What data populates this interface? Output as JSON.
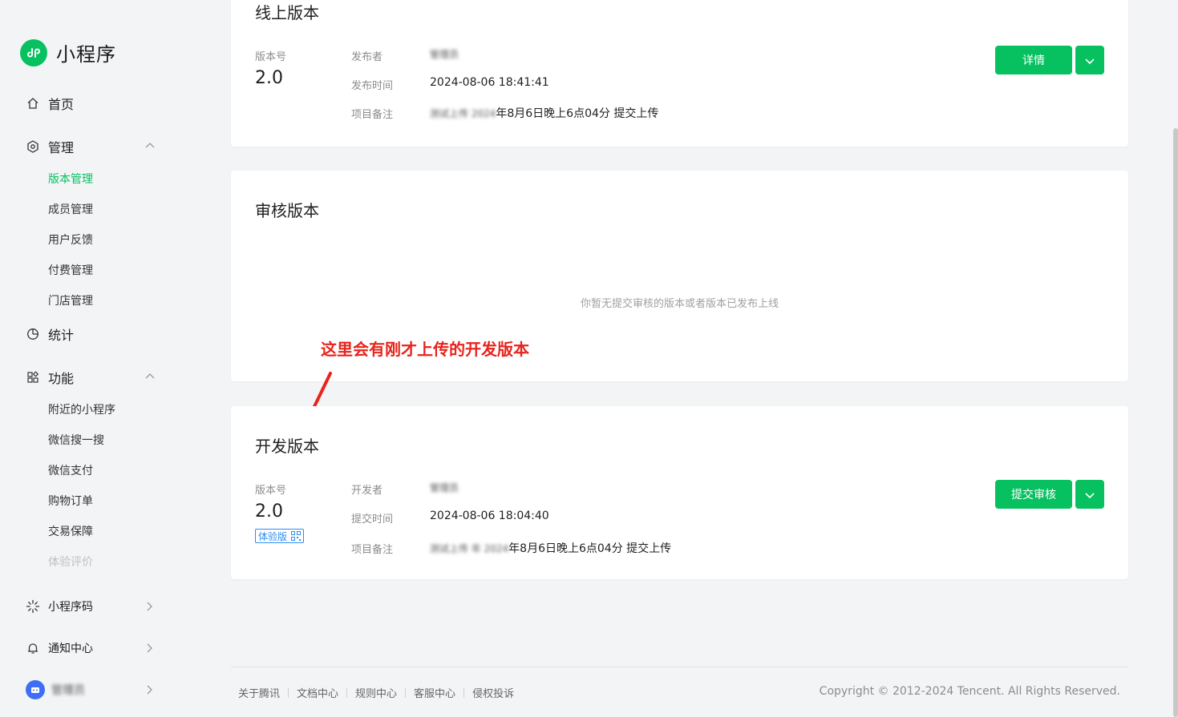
{
  "app": {
    "name": "小程序"
  },
  "sidebar": {
    "home": "首页",
    "manage": {
      "label": "管理",
      "items": [
        "版本管理",
        "成员管理",
        "用户反馈",
        "付费管理",
        "门店管理"
      ]
    },
    "stats": "统计",
    "features": {
      "label": "功能",
      "items": [
        "附近的小程序",
        "微信搜一搜",
        "微信支付",
        "购物订单",
        "交易保障",
        "体验评价"
      ]
    },
    "mini_code": "小程序码",
    "notify": "通知中心",
    "account": "管理员"
  },
  "online": {
    "title": "线上版本",
    "version_label": "版本号",
    "version": "2.0",
    "publisher_label": "发布者",
    "publisher": "管理员",
    "time_label": "发布时间",
    "time": "2024-08-06 18:41:41",
    "note_label": "项目备注",
    "note_hidden": "测试上传 2024",
    "note": "年8月6日晚上6点04分 提交上传",
    "button": "详情"
  },
  "review": {
    "title": "审核版本",
    "empty": "你暂无提交审核的版本或者版本已发布上线"
  },
  "annotation": "这里会有刚才上传的开发版本",
  "dev": {
    "title": "开发版本",
    "version_label": "版本号",
    "version": "2.0",
    "tag": "体验版",
    "developer_label": "开发者",
    "developer": "管理员",
    "time_label": "提交时间",
    "time": "2024-08-06 18:04:40",
    "note_label": "项目备注",
    "note_hidden": "测试上传 年 2024",
    "note": "年8月6日晚上6点04分 提交上传",
    "button": "提交审核"
  },
  "footer": {
    "links": [
      "关于腾讯",
      "文档中心",
      "规则中心",
      "客服中心",
      "侵权投诉"
    ],
    "copyright": "Copyright © 2012-2024 Tencent. All Rights Reserved."
  },
  "colors": {
    "brand": "#07c160",
    "annotation": "#e8231c",
    "link_blue": "#2d8cf0"
  }
}
